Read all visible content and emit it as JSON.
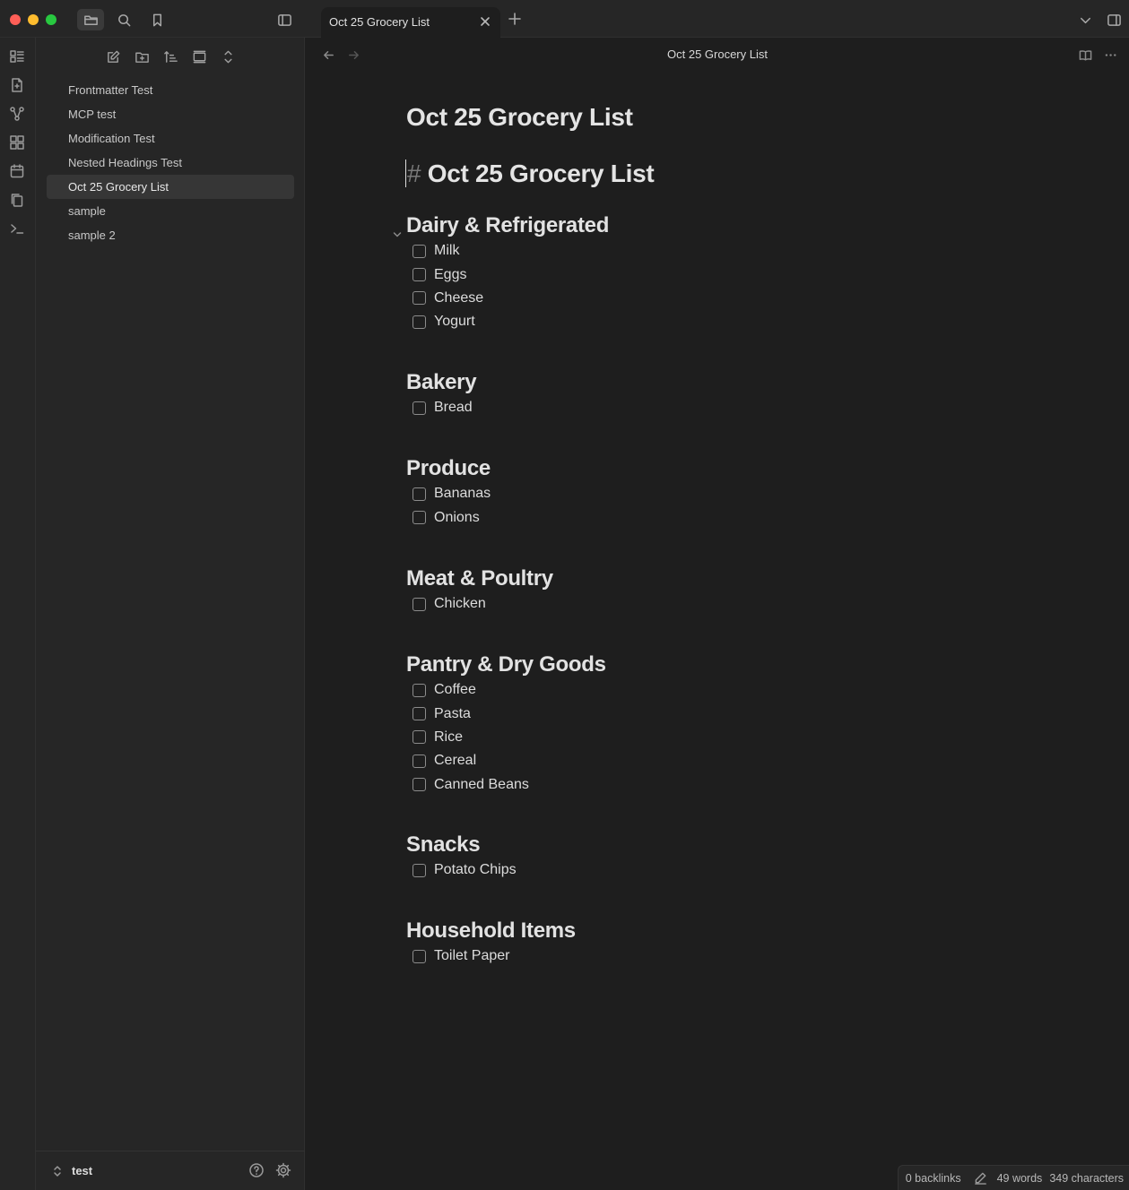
{
  "window": {
    "tab_title": "Oct 25 Grocery List"
  },
  "sidebar": {
    "files": [
      "Frontmatter Test",
      "MCP test",
      "Modification Test",
      "Nested Headings Test",
      "Oct 25 Grocery List",
      "sample",
      "sample 2"
    ],
    "active_file": "Oct 25 Grocery List",
    "vault_name": "test"
  },
  "editor": {
    "view_title": "Oct 25 Grocery List",
    "inline_title": "Oct 25 Grocery List",
    "h1_hash": "#",
    "h1_text": " Oct 25 Grocery List",
    "sections": [
      {
        "heading": "Dairy & Refrigerated",
        "items": [
          "Milk",
          "Eggs",
          "Cheese",
          "Yogurt"
        ]
      },
      {
        "heading": "Bakery",
        "items": [
          "Bread"
        ]
      },
      {
        "heading": "Produce",
        "items": [
          "Bananas",
          "Onions"
        ]
      },
      {
        "heading": "Meat & Poultry",
        "items": [
          "Chicken"
        ]
      },
      {
        "heading": "Pantry & Dry Goods",
        "items": [
          "Coffee",
          "Pasta",
          "Rice",
          "Cereal",
          "Canned Beans"
        ]
      },
      {
        "heading": "Snacks",
        "items": [
          "Potato Chips"
        ]
      },
      {
        "heading": "Household Items",
        "items": [
          "Toilet Paper"
        ]
      }
    ]
  },
  "status_bar": {
    "backlinks": "0 backlinks",
    "words": "49 words",
    "characters": "349 characters"
  }
}
